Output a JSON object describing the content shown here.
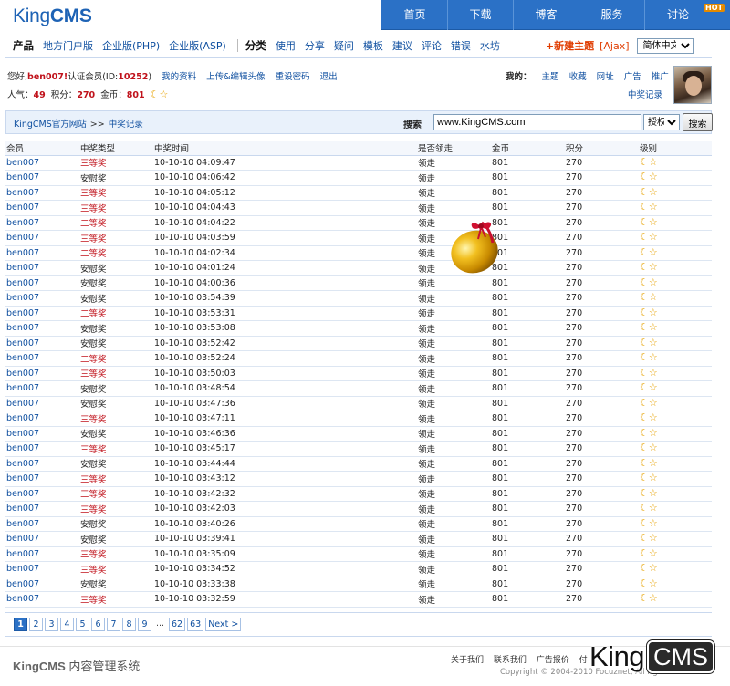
{
  "header": {
    "logo_light": "King",
    "logo_bold": "CMS",
    "nav": [
      "首页",
      "下载",
      "博客",
      "服务",
      "讨论"
    ],
    "hot_badge": "HOT"
  },
  "subnav": {
    "product_heading": "产品",
    "product_links": [
      "地方门户版",
      "企业版(PHP)",
      "企业版(ASP)"
    ],
    "category_heading": "分类",
    "category_links": [
      "使用",
      "分享",
      "疑问",
      "模板",
      "建议",
      "评论",
      "错误",
      "水坊"
    ],
    "new_topic": "+新建主题",
    "ajax": "[Ajax]",
    "language": "简体中文"
  },
  "user": {
    "greeting": "您好,",
    "username": "ben007!",
    "cert": "认证会员",
    "id_prefix": "(ID:",
    "id": "10252",
    "id_suffix": ")",
    "links": [
      "我的资料",
      "上传&编辑头像",
      "重设密码",
      "退出"
    ],
    "popularity_label": "人气：",
    "popularity": "49",
    "points_label": "积分：",
    "points": "270",
    "coins_label": "金币：",
    "coins": "801",
    "my_label": "我的：",
    "my_links": [
      "主题",
      "收藏",
      "网址",
      "广告",
      "推广"
    ],
    "lottery_link": "中奖记录"
  },
  "breadcrumb": {
    "home": "KingCMS官方网站",
    "sep": ">>",
    "current": "中奖记录"
  },
  "search": {
    "label": "搜索",
    "value": "www.KingCMS.com",
    "scope": "授权",
    "button": "搜索"
  },
  "table": {
    "headers": [
      "会员",
      "中奖类型",
      "中奖时间",
      "是否领走",
      "金币",
      "积分",
      "级别"
    ],
    "rows": [
      [
        "ben007",
        "三等奖",
        "10-10-10 04:09:47",
        "领走",
        "801",
        "270"
      ],
      [
        "ben007",
        "安慰奖",
        "10-10-10 04:06:42",
        "领走",
        "801",
        "270"
      ],
      [
        "ben007",
        "三等奖",
        "10-10-10 04:05:12",
        "领走",
        "801",
        "270"
      ],
      [
        "ben007",
        "三等奖",
        "10-10-10 04:04:43",
        "领走",
        "801",
        "270"
      ],
      [
        "ben007",
        "二等奖",
        "10-10-10 04:04:22",
        "领走",
        "801",
        "270"
      ],
      [
        "ben007",
        "三等奖",
        "10-10-10 04:03:59",
        "领走",
        "801",
        "270"
      ],
      [
        "ben007",
        "二等奖",
        "10-10-10 04:02:34",
        "领走",
        "801",
        "270"
      ],
      [
        "ben007",
        "安慰奖",
        "10-10-10 04:01:24",
        "领走",
        "801",
        "270"
      ],
      [
        "ben007",
        "安慰奖",
        "10-10-10 04:00:36",
        "领走",
        "801",
        "270"
      ],
      [
        "ben007",
        "安慰奖",
        "10-10-10 03:54:39",
        "领走",
        "801",
        "270"
      ],
      [
        "ben007",
        "二等奖",
        "10-10-10 03:53:31",
        "领走",
        "801",
        "270"
      ],
      [
        "ben007",
        "安慰奖",
        "10-10-10 03:53:08",
        "领走",
        "801",
        "270"
      ],
      [
        "ben007",
        "安慰奖",
        "10-10-10 03:52:42",
        "领走",
        "801",
        "270"
      ],
      [
        "ben007",
        "二等奖",
        "10-10-10 03:52:24",
        "领走",
        "801",
        "270"
      ],
      [
        "ben007",
        "三等奖",
        "10-10-10 03:50:03",
        "领走",
        "801",
        "270"
      ],
      [
        "ben007",
        "安慰奖",
        "10-10-10 03:48:54",
        "领走",
        "801",
        "270"
      ],
      [
        "ben007",
        "安慰奖",
        "10-10-10 03:47:36",
        "领走",
        "801",
        "270"
      ],
      [
        "ben007",
        "三等奖",
        "10-10-10 03:47:11",
        "领走",
        "801",
        "270"
      ],
      [
        "ben007",
        "安慰奖",
        "10-10-10 03:46:36",
        "领走",
        "801",
        "270"
      ],
      [
        "ben007",
        "三等奖",
        "10-10-10 03:45:17",
        "领走",
        "801",
        "270"
      ],
      [
        "ben007",
        "安慰奖",
        "10-10-10 03:44:44",
        "领走",
        "801",
        "270"
      ],
      [
        "ben007",
        "三等奖",
        "10-10-10 03:43:12",
        "领走",
        "801",
        "270"
      ],
      [
        "ben007",
        "三等奖",
        "10-10-10 03:42:32",
        "领走",
        "801",
        "270"
      ],
      [
        "ben007",
        "三等奖",
        "10-10-10 03:42:03",
        "领走",
        "801",
        "270"
      ],
      [
        "ben007",
        "安慰奖",
        "10-10-10 03:40:26",
        "领走",
        "801",
        "270"
      ],
      [
        "ben007",
        "安慰奖",
        "10-10-10 03:39:41",
        "领走",
        "801",
        "270"
      ],
      [
        "ben007",
        "三等奖",
        "10-10-10 03:35:09",
        "领走",
        "801",
        "270"
      ],
      [
        "ben007",
        "三等奖",
        "10-10-10 03:34:52",
        "领走",
        "801",
        "270"
      ],
      [
        "ben007",
        "安慰奖",
        "10-10-10 03:33:38",
        "领走",
        "801",
        "270"
      ],
      [
        "ben007",
        "三等奖",
        "10-10-10 03:32:59",
        "领走",
        "801",
        "270"
      ]
    ],
    "level_icons": [
      "moon-icon",
      "star-icon"
    ]
  },
  "pager": {
    "current": "1",
    "pages": [
      "2",
      "3",
      "4",
      "5",
      "6",
      "7",
      "8",
      "9"
    ],
    "dots": "...",
    "tail": [
      "62",
      "63"
    ],
    "next": "Next >"
  },
  "footer": {
    "brand_bold": "KingCMS",
    "brand_rest": " 内容管理系统",
    "links": [
      "关于我们",
      "联系我们",
      "广告报价",
      "付"
    ],
    "copyright": "Copyright © 2004-2010 Focuznet, All rights reserved"
  },
  "watermark": {
    "king": "King",
    "cms": "CMS"
  },
  "colors": {
    "primary": "#2b71c6",
    "accent_red": "#c0121b",
    "link": "#1050a0",
    "star": "#e7a200"
  }
}
